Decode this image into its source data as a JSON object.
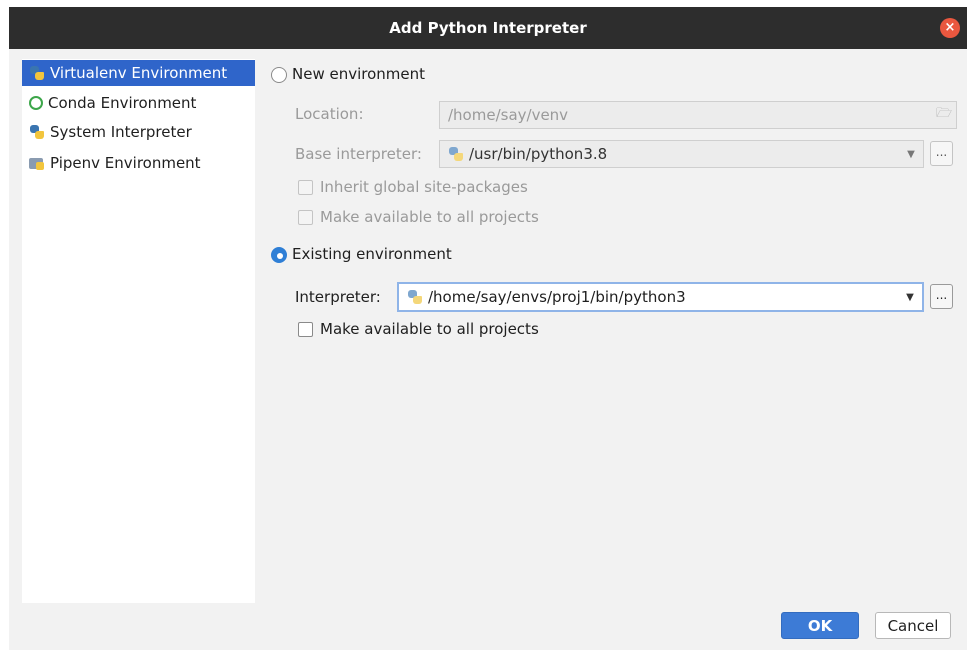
{
  "window": {
    "title": "Add Python Interpreter"
  },
  "sidebar": {
    "items": [
      {
        "label": "Virtualenv Environment",
        "icon": "virtualenv-icon",
        "selected": true
      },
      {
        "label": "Conda Environment",
        "icon": "conda-icon",
        "selected": false
      },
      {
        "label": "System Interpreter",
        "icon": "python-icon",
        "selected": false
      },
      {
        "label": "Pipenv Environment",
        "icon": "pipenv-icon",
        "selected": false
      }
    ]
  },
  "new_env": {
    "radio_label": "New environment",
    "selected": false,
    "location_label": "Location:",
    "location_value": "/home/say/venv",
    "base_label": "Base interpreter:",
    "base_value": "/usr/bin/python3.8",
    "inherit_label": "Inherit global site-packages",
    "inherit_checked": false,
    "make_available_label": "Make available to all projects",
    "make_available_checked": false
  },
  "existing_env": {
    "radio_label": "Existing environment",
    "selected": true,
    "interpreter_label": "Interpreter:",
    "interpreter_value": "/home/say/envs/proj1/bin/python3",
    "make_available_label": "Make available to all projects",
    "make_available_checked": false
  },
  "buttons": {
    "ok": "OK",
    "cancel": "Cancel",
    "browse": "..."
  },
  "colors": {
    "titlebar": "#2d2d2d",
    "selection": "#2f65ca",
    "ok_button": "#3d7bd6",
    "close_button": "#e9573f"
  }
}
